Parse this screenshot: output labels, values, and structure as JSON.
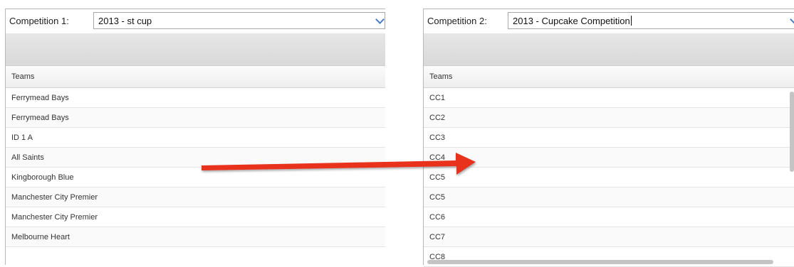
{
  "left": {
    "label": "Competition 1:",
    "selected": "2013 - st cup",
    "column_header": "Teams",
    "teams": [
      "Ferrymead Bays",
      "Ferrymead Bays",
      "ID 1 A",
      "All Saints",
      "Kingborough Blue",
      "Manchester City Premier",
      "Manchester City Premier",
      "Melbourne Heart"
    ]
  },
  "right": {
    "label": "Competition 2:",
    "selected": "2013 - Cupcake Competition",
    "column_header": "Teams",
    "teams": [
      "CC1",
      "CC2",
      "CC3",
      "CC4",
      "CC5",
      "CC5",
      "CC6",
      "CC7",
      "CC8"
    ]
  },
  "arrow_color": "#e8321e",
  "caret_color": "#4a7cc4"
}
